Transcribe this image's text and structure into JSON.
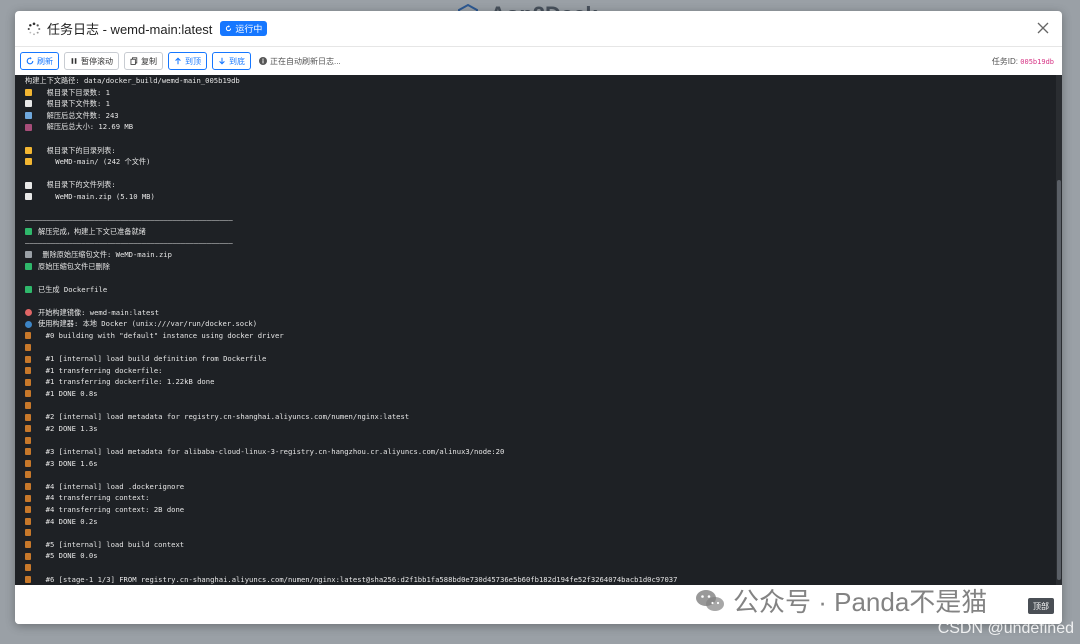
{
  "background": {
    "app_title": "Aop2Deck"
  },
  "modal": {
    "title": "任务日志 - wemd-main:latest",
    "status_badge": "运行中",
    "close_label": "×"
  },
  "toolbar": {
    "refresh_label": "刷新",
    "pause_label": "暂停滚动",
    "copy_label": "复制",
    "top_label": "到顶",
    "bottom_label": "到底",
    "auto_refresh_text": "正在自动刷新日志...",
    "task_id_label": "任务ID:",
    "task_id_value": "005b19db"
  },
  "log_lines": [
    {
      "icon": "",
      "text": "构建上下文路径: data/docker_build/wemd-main_005b19db"
    },
    {
      "icon": "folder",
      "text": "  根目录下目录数: 1"
    },
    {
      "icon": "file",
      "text": "  根目录下文件数: 1"
    },
    {
      "icon": "chart",
      "text": "  解压后总文件数: 243"
    },
    {
      "icon": "disk",
      "text": "  解压后总大小: 12.69 MB"
    },
    {
      "icon": "",
      "text": ""
    },
    {
      "icon": "folder",
      "text": "  根目录下的目录列表:"
    },
    {
      "icon": "folder",
      "text": "    WeMD-main/ (242 个文件)"
    },
    {
      "icon": "",
      "text": ""
    },
    {
      "icon": "file",
      "text": "  根目录下的文件列表:"
    },
    {
      "icon": "file",
      "text": "    WeMD-main.zip (5.10 MB)"
    },
    {
      "icon": "",
      "text": ""
    },
    {
      "icon": "",
      "text": "————————————————————————————————————————————————"
    },
    {
      "icon": "check",
      "text": "解压完成，构建上下文已准备就绪"
    },
    {
      "icon": "",
      "text": "————————————————————————————————————————————————"
    },
    {
      "icon": "trash",
      "text": " 删除原始压缩包文件: WeMD-main.zip"
    },
    {
      "icon": "check",
      "text": "原始压缩包文件已删除"
    },
    {
      "icon": "",
      "text": ""
    },
    {
      "icon": "check",
      "text": "已生成 Dockerfile"
    },
    {
      "icon": "",
      "text": ""
    },
    {
      "icon": "rocket",
      "text": "开始构建镜像: wemd-main:latest"
    },
    {
      "icon": "globe",
      "text": "使用构建器: 本地 Docker (unix:///var/run/docker.sock)"
    },
    {
      "icon": "fire",
      "text": "  #0 building with \"default\" instance using docker driver"
    },
    {
      "icon": "fire",
      "text": ""
    },
    {
      "icon": "fire",
      "text": "  #1 [internal] load build definition from Dockerfile"
    },
    {
      "icon": "fire",
      "text": "  #1 transferring dockerfile:"
    },
    {
      "icon": "fire",
      "text": "  #1 transferring dockerfile: 1.22kB done"
    },
    {
      "icon": "fire",
      "text": "  #1 DONE 0.8s"
    },
    {
      "icon": "fire",
      "text": ""
    },
    {
      "icon": "fire",
      "text": "  #2 [internal] load metadata for registry.cn-shanghai.aliyuncs.com/numen/nginx:latest"
    },
    {
      "icon": "fire",
      "text": "  #2 DONE 1.3s"
    },
    {
      "icon": "fire",
      "text": ""
    },
    {
      "icon": "fire",
      "text": "  #3 [internal] load metadata for alibaba-cloud-linux-3-registry.cn-hangzhou.cr.aliyuncs.com/alinux3/node:20"
    },
    {
      "icon": "fire",
      "text": "  #3 DONE 1.6s"
    },
    {
      "icon": "fire",
      "text": ""
    },
    {
      "icon": "fire",
      "text": "  #4 [internal] load .dockerignore"
    },
    {
      "icon": "fire",
      "text": "  #4 transferring context:"
    },
    {
      "icon": "fire",
      "text": "  #4 transferring context: 2B done"
    },
    {
      "icon": "fire",
      "text": "  #4 DONE 0.2s"
    },
    {
      "icon": "fire",
      "text": ""
    },
    {
      "icon": "fire",
      "text": "  #5 [internal] load build context"
    },
    {
      "icon": "fire",
      "text": "  #5 DONE 0.0s"
    },
    {
      "icon": "fire",
      "text": ""
    },
    {
      "icon": "fire",
      "text": "  #6 [stage-1 1/3] FROM registry.cn-shanghai.aliyuncs.com/numen/nginx:latest@sha256:d2f1bb1fa588bd0e730d45736e5b60fb182d194fe52f3264074bacb1d0c97037"
    }
  ],
  "scroll_top_label": "顶部",
  "watermark": {
    "text": "公众号 · Panda不是猫",
    "csdn": "CSDN @undefined"
  }
}
